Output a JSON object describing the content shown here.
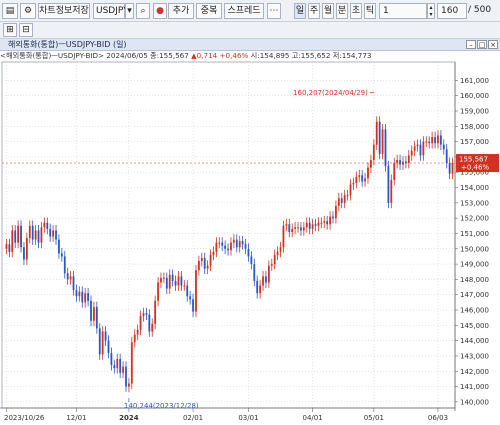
{
  "toolbar": {
    "menu_icon": "menu-bars-icon",
    "save_label": "차트정보저장",
    "symbol": "USDJPY",
    "add_label": "추가",
    "overlap_label": "중복",
    "spread_label": "스프레드",
    "period_tabs": [
      "일",
      "주",
      "월",
      "분",
      "초",
      "틱"
    ],
    "period_value": "1",
    "count_value": "160",
    "count_total": "500"
  },
  "panel": {
    "title": "해외통화(통합)ㅡUSDJPY-BID (일)",
    "info_prefix": "<해외통화(통합)ㅡUSDJPY-BID> 2024/06/05 종:155,567",
    "info_change": "▲0,714 +0,46%",
    "info_rest": "시:154,895 고:155,652 저:154,773"
  },
  "colors": {
    "up": "#d2311f",
    "down": "#2a56c6",
    "bg": "#ffffff",
    "grid": "#c8c8c8"
  },
  "chart_data": {
    "type": "candlestick",
    "title": "해외통화(통합)ㅡUSDJPY-BID (일)",
    "ylim": [
      139.6,
      162.2
    ],
    "y_ticks": [
      "140,000",
      "141,000",
      "142,000",
      "143,000",
      "144,000",
      "145,000",
      "146,000",
      "147,000",
      "148,000",
      "149,000",
      "150,000",
      "151,000",
      "152,000",
      "153,000",
      "154,000",
      "155,000",
      "156,000",
      "157,000",
      "158,000",
      "159,000",
      "160,000",
      "161,000"
    ],
    "y_tick_values": [
      140,
      141,
      142,
      143,
      144,
      145,
      146,
      147,
      148,
      149,
      150,
      151,
      152,
      153,
      154,
      155,
      156,
      157,
      158,
      159,
      160,
      161
    ],
    "x_labels": [
      "2023/10/26",
      "12/01",
      "2024",
      "02/01",
      "03/01",
      "04/01",
      "05/01",
      "06/03"
    ],
    "x_label_index": [
      0,
      24,
      42,
      64,
      83,
      105,
      126,
      148
    ],
    "closes": [
      150.3,
      149.8,
      151.2,
      150.4,
      151.5,
      150.1,
      149.3,
      150.7,
      151.5,
      150.6,
      151.2,
      150.4,
      151.4,
      151.7,
      151.3,
      150.8,
      151.2,
      150.6,
      149.7,
      149.5,
      148.4,
      148.0,
      148.2,
      147.3,
      146.9,
      147.2,
      146.5,
      147.1,
      146.6,
      145.3,
      146.2,
      144.8,
      143.1,
      144.6,
      144.0,
      143.2,
      142.4,
      142.2,
      142.8,
      141.9,
      142.3,
      141.0,
      141.2,
      143.9,
      144.4,
      144.7,
      145.6,
      145.8,
      145.7,
      144.6,
      145.1,
      146.6,
      147.8,
      148.1,
      148.1,
      147.4,
      148.3,
      147.9,
      147.6,
      148.2,
      147.6,
      147.6,
      146.9,
      146.7,
      145.9,
      148.6,
      149.2,
      149.4,
      148.7,
      148.9,
      149.6,
      149.8,
      150.4,
      150.4,
      150.2,
      150.0,
      149.9,
      150.4,
      150.6,
      150.1,
      150.5,
      150.3,
      150.0,
      149.5,
      149.0,
      147.9,
      147.1,
      147.6,
      148.2,
      147.8,
      148.9,
      149.0,
      149.6,
      149.8,
      150.1,
      151.5,
      151.6,
      151.1,
      151.3,
      151.4,
      151.4,
      151.2,
      151.4,
      151.7,
      151.3,
      151.6,
      151.5,
      151.7,
      151.7,
      151.8,
      151.6,
      152.1,
      152.0,
      152.8,
      153.3,
      153.0,
      153.5,
      153.5,
      154.2,
      154.3,
      154.7,
      154.8,
      154.4,
      154.6,
      155.3,
      155.8,
      156.8,
      158.3,
      156.2,
      157.8,
      155.4,
      153.0,
      154.5,
      155.6,
      155.8,
      155.5,
      155.7,
      155.6,
      156.1,
      156.4,
      156.7,
      156.8,
      156.1,
      157.0,
      157.0,
      156.9,
      157.3,
      156.9,
      157.4,
      156.8,
      156.5,
      155.6,
      154.9,
      155.6
    ],
    "last_price": "155,567",
    "last_change": "+0,46%",
    "annotations": [
      {
        "text": "160,207(2024/04/29)",
        "index": 126,
        "value": 160.207
      },
      {
        "text": "140,244(2023/12/28)",
        "index": 42,
        "value": 140.244
      }
    ]
  }
}
